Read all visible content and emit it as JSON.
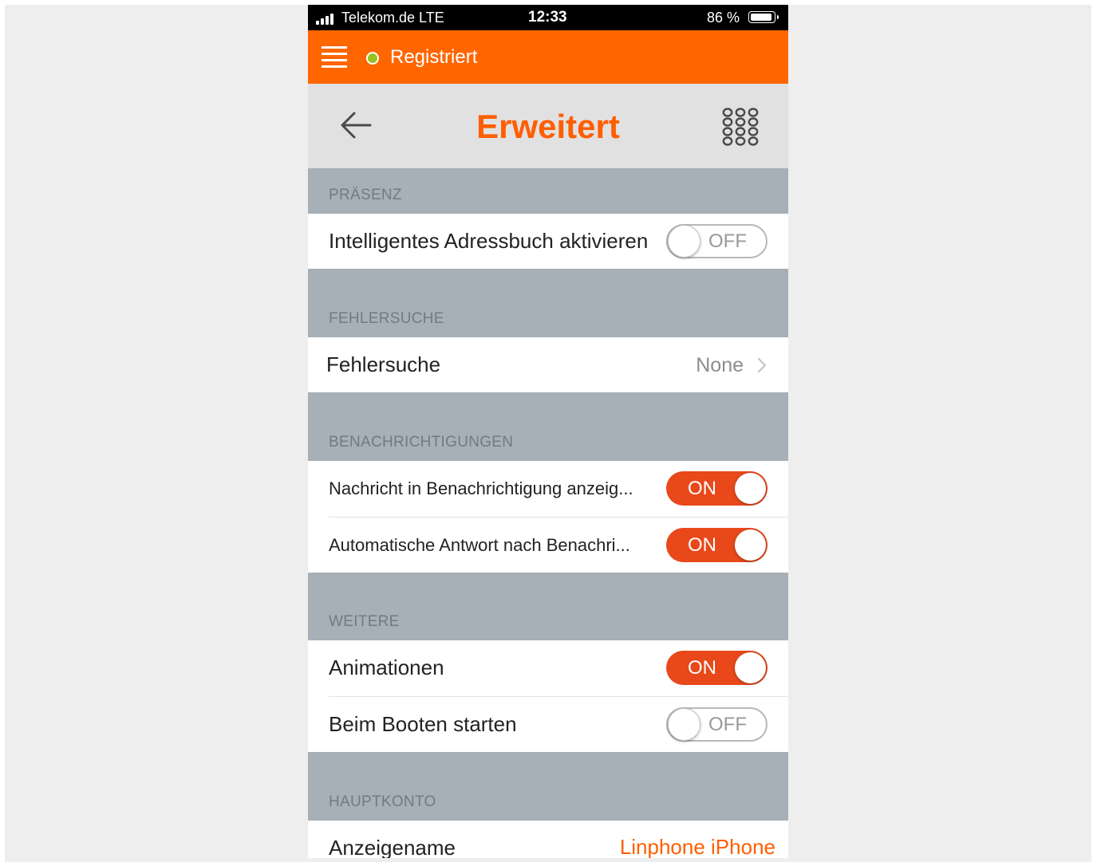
{
  "status_bar": {
    "carrier": "Telekom.de  LTE",
    "time": "12:33",
    "battery": "86 %"
  },
  "top_bar": {
    "registration_status": "Registriert",
    "status_color": "#96c11f",
    "accent_color": "#ff6600"
  },
  "header": {
    "title": "Erweitert",
    "back_icon": "back-arrow-icon",
    "dialpad_icon": "dialpad-icon"
  },
  "sections": {
    "presence": {
      "title": "PRÄSENZ",
      "smart_addressbook": {
        "label": "Intelligentes Adressbuch aktivieren",
        "state": "OFF"
      }
    },
    "debug": {
      "title": "FEHLERSUCHE",
      "debug_level": {
        "label": "Fehlersuche",
        "value": "None"
      }
    },
    "notifications": {
      "title": "BENACHRICHTIGUNGEN",
      "show_message": {
        "label": "Nachricht in Benachrichtigung anzeig...",
        "state": "ON"
      },
      "auto_reply": {
        "label": "Automatische Antwort nach Benachri...",
        "state": "ON"
      }
    },
    "other": {
      "title": "WEITERE",
      "animations": {
        "label": "Animationen",
        "state": "ON"
      },
      "start_at_boot": {
        "label": "Beim Booten starten",
        "state": "OFF"
      }
    },
    "main_account": {
      "title": "HAUPTKONTO",
      "display_name": {
        "label": "Anzeigename",
        "value": "Linphone iPhone"
      }
    }
  }
}
